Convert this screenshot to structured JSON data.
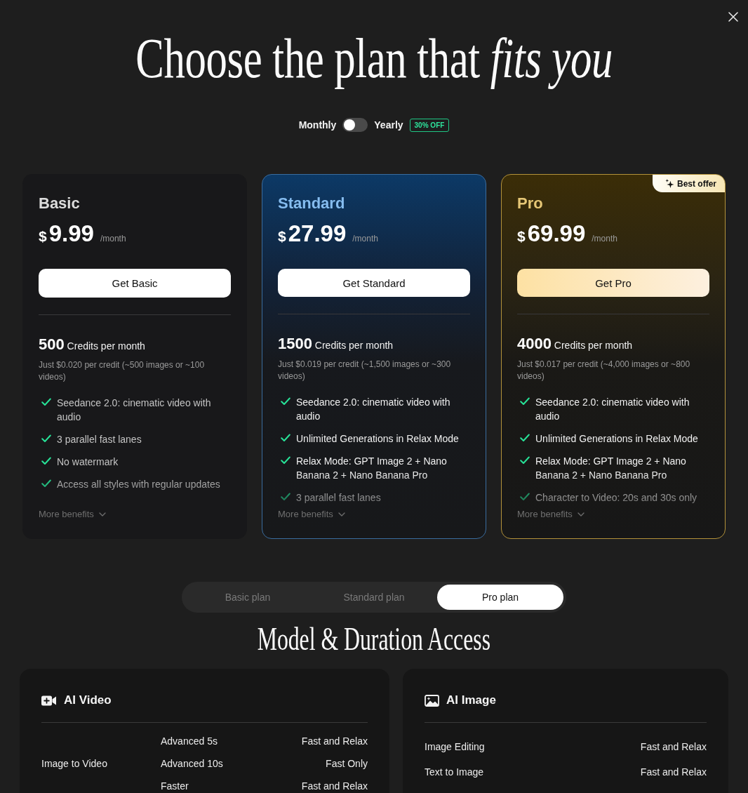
{
  "heading": "Choose the plan that *fits you*",
  "billing_toggle": {
    "left_label": "Monthly",
    "on": false,
    "right_label": "Yearly",
    "badge": "30% OFF"
  },
  "plans": [
    {
      "kind": "basic",
      "name": "Basic",
      "currency": "$",
      "price": "9.99",
      "period": "/month",
      "button": "Get Basic",
      "credits": "500",
      "credits_label": "Credits per month",
      "credit_note": "Just $0.020 per credit (~500 images or ~100 videos)",
      "features": [
        "Seedance 2.0: cinematic video with audio",
        "3 parallel fast lanes",
        "No watermark",
        "Access all styles with regular updates"
      ],
      "more": "More benefits"
    },
    {
      "kind": "standard",
      "name": "Standard",
      "currency": "$",
      "price": "27.99",
      "period": "/month",
      "button": "Get Standard",
      "credits": "1500",
      "credits_label": "Credits per month",
      "credit_note": "Just $0.019 per credit (~1,500 images or ~300 videos)",
      "features": [
        "Seedance 2.0: cinematic video with audio",
        "Unlimited Generations in Relax Mode",
        "Relax Mode: GPT Image 2 + Nano Banana 2 + Nano Banana Pro",
        "3 parallel fast lanes"
      ],
      "more": "More benefits"
    },
    {
      "kind": "pro",
      "name": "Pro",
      "badge": "Best offer",
      "currency": "$",
      "price": "69.99",
      "period": "/month",
      "button": "Get Pro",
      "credits": "4000",
      "credits_label": "Credits per month",
      "credit_note": "Just $0.017 per credit (~4,000 images or ~800 videos)",
      "features": [
        "Seedance 2.0: cinematic video with audio",
        "Unlimited Generations in Relax Mode",
        "Relax Mode: GPT Image 2 + Nano Banana 2 + Nano Banana Pro",
        "Character to Video: 20s and 30s only"
      ],
      "more": "More benefits"
    }
  ],
  "plan_tabs": [
    {
      "label": "Basic plan",
      "selected": false
    },
    {
      "label": "Standard plan",
      "selected": false
    },
    {
      "label": "Pro plan",
      "selected": true
    }
  ],
  "access_heading": "Model & Duration Access",
  "access_panels": [
    {
      "kind": "video",
      "title": "AI Video",
      "groups": [
        {
          "label": "Image to Video",
          "entries": [
            {
              "model": "Advanced 5s",
              "mode": "Fast and Relax"
            },
            {
              "model": "Advanced 10s",
              "mode": "Fast Only"
            },
            {
              "model": "Faster",
              "mode": "Fast and Relax"
            }
          ]
        }
      ]
    },
    {
      "kind": "image",
      "title": "AI Image",
      "groups": [
        {
          "label": "Image Editing",
          "entries": [
            {
              "mode": "Fast and Relax"
            }
          ]
        },
        {
          "label": "Text to Image",
          "entries": [
            {
              "mode": "Fast and Relax"
            }
          ]
        }
      ]
    }
  ]
}
